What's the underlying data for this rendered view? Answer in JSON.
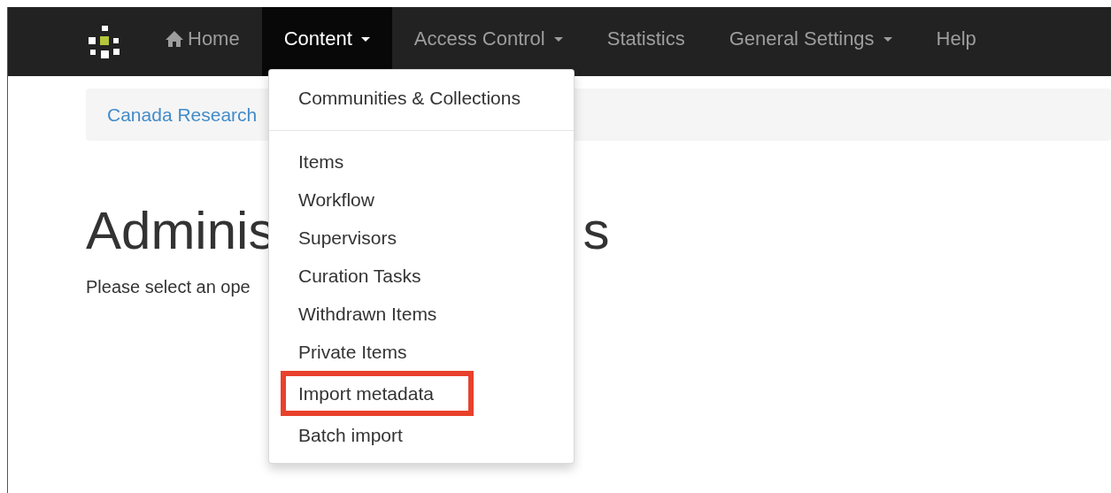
{
  "navbar": {
    "items": [
      {
        "label": "Home",
        "kind": "home",
        "selected": false,
        "caret": false
      },
      {
        "label": "Content",
        "kind": "menu",
        "selected": true,
        "caret": true
      },
      {
        "label": "Access Control",
        "kind": "menu",
        "selected": false,
        "caret": true
      },
      {
        "label": "Statistics",
        "kind": "menu",
        "selected": false,
        "caret": false
      },
      {
        "label": "General Settings",
        "kind": "menu",
        "selected": false,
        "caret": true
      },
      {
        "label": "Help",
        "kind": "menu",
        "selected": false,
        "caret": false
      }
    ]
  },
  "breadcrumb": "Canada Research",
  "heading": {
    "start": "Adminis",
    "end": "s"
  },
  "intro": "Please select an ope",
  "dropdown": {
    "groups": [
      [
        {
          "label": "Communities & Collections",
          "highlighted": false
        }
      ],
      [
        {
          "label": "Items",
          "highlighted": false
        },
        {
          "label": "Workflow",
          "highlighted": false
        },
        {
          "label": "Supervisors",
          "highlighted": false
        },
        {
          "label": "Curation Tasks",
          "highlighted": false
        },
        {
          "label": "Withdrawn Items",
          "highlighted": false
        },
        {
          "label": "Private Items",
          "highlighted": false
        },
        {
          "label": "Import metadata",
          "highlighted": true
        },
        {
          "label": "Batch import",
          "highlighted": false
        }
      ]
    ]
  }
}
